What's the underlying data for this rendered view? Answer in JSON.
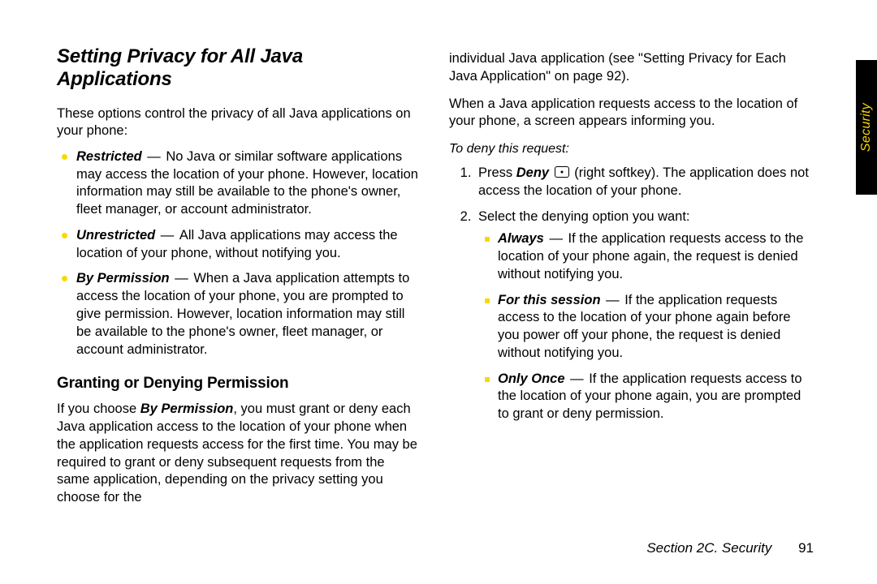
{
  "tab_label": "Security",
  "footer": {
    "section": "Section 2C. Security",
    "page": "91"
  },
  "left": {
    "title": "Setting Privacy for All Java Applications",
    "intro": "These options control the privacy of all Java applications on your phone:",
    "options": [
      {
        "term": "Restricted",
        "desc": "No Java or similar software applications may access the location of your phone. However, location information may still be available to the phone's owner, fleet manager, or account administrator."
      },
      {
        "term": "Unrestricted",
        "desc": "All Java applications may access the location of your phone, without notifying you."
      },
      {
        "term": "By Permission",
        "desc": "When a Java application attempts to access the location of your phone, you are prompted to give permission. However, location information may still be available to the phone's owner, fleet manager, or account administrator."
      }
    ],
    "subhead": "Granting or Denying Permission",
    "subpara_before": "If you choose ",
    "subpara_term": "By Permission",
    "subpara_after": ", you must grant or deny each Java application access to the location of your phone when the application requests access for the first time. You may be required to grant or deny subsequent requests from the same application, depending on the privacy setting you choose for the"
  },
  "right": {
    "cont": "individual Java application (see \"Setting Privacy for Each Java Application\" on page 92).",
    "para2": "When a Java application requests access to the location of your phone, a screen appears informing you.",
    "instr": "To deny this request:",
    "step1_before": "Press ",
    "step1_term": "Deny",
    "step1_after": " (right softkey). The application does not access the location of your phone.",
    "step2": "Select the denying option you want:",
    "subopts": [
      {
        "term": "Always",
        "desc": "If the application requests access to the location of your phone again, the request is denied without notifying you."
      },
      {
        "term": "For this session",
        "desc": "If the application requests access to the location of your phone again before you power off your phone, the request is denied without notifying you."
      },
      {
        "term": "Only Once",
        "desc": "If the application requests access to the location of your phone again, you are prompted to grant or deny permission."
      }
    ]
  }
}
